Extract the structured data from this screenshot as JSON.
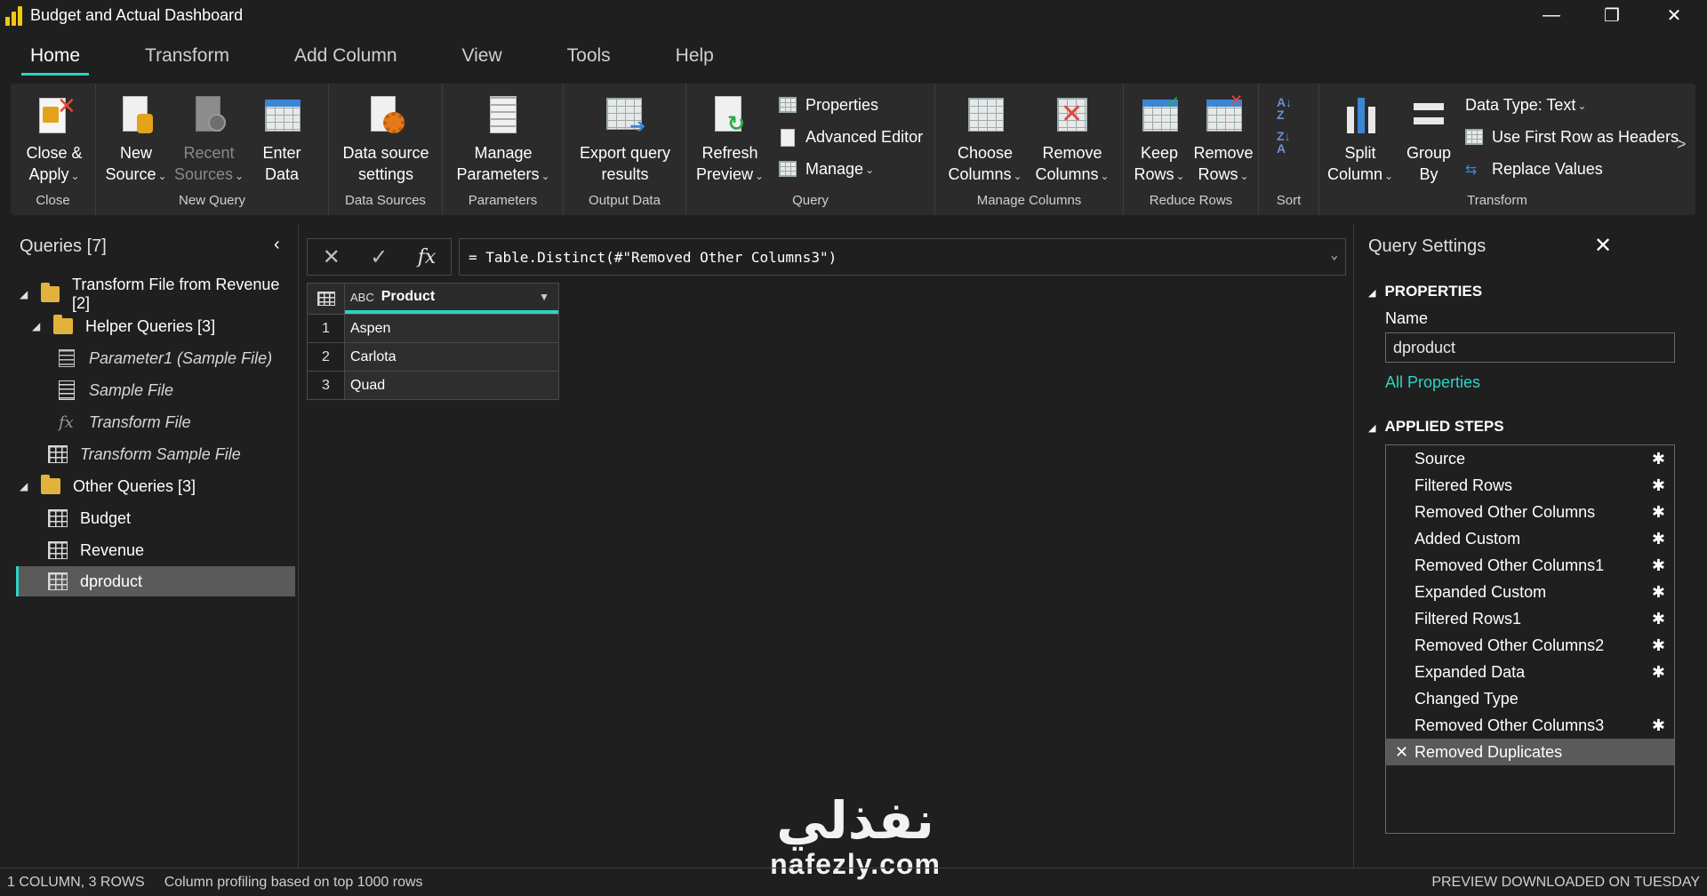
{
  "window": {
    "title": "Budget and Actual Dashboard"
  },
  "menu": {
    "tabs": [
      "Home",
      "Transform",
      "Add Column",
      "View",
      "Tools",
      "Help"
    ],
    "active": "Home"
  },
  "ribbon": {
    "close": {
      "label": "Close",
      "close_apply": "Close &",
      "close_apply2": "Apply"
    },
    "new_query": {
      "label": "New Query",
      "new_source": "New",
      "new_source2": "Source",
      "recent_sources": "Recent",
      "recent_sources2": "Sources",
      "enter_data": "Enter",
      "enter_data2": "Data"
    },
    "data_sources": {
      "label": "Data Sources",
      "settings": "Data source",
      "settings2": "settings"
    },
    "parameters": {
      "label": "Parameters",
      "manage": "Manage",
      "manage2": "Parameters"
    },
    "output_data": {
      "label": "Output Data",
      "export": "Export query",
      "export2": "results"
    },
    "query": {
      "label": "Query",
      "refresh": "Refresh",
      "refresh2": "Preview",
      "properties": "Properties",
      "advanced_editor": "Advanced Editor",
      "manage": "Manage"
    },
    "manage_columns": {
      "label": "Manage Columns",
      "choose": "Choose",
      "choose2": "Columns",
      "remove": "Remove",
      "remove2": "Columns"
    },
    "reduce_rows": {
      "label": "Reduce Rows",
      "keep": "Keep",
      "keep2": "Rows",
      "remove": "Remove",
      "remove2": "Rows"
    },
    "sort": {
      "label": "Sort"
    },
    "transform": {
      "label": "Transform",
      "split": "Split",
      "split2": "Column",
      "group": "Group",
      "group2": "By",
      "data_type": "Data Type: Text",
      "first_row": "Use First Row as Headers",
      "replace": "Replace Values"
    },
    "more": ">"
  },
  "queries": {
    "title": "Queries [7]",
    "items": [
      {
        "label": "Transform File from Revenue [2]"
      },
      {
        "label": "Helper Queries [3]"
      },
      {
        "label": "Parameter1 (Sample File)"
      },
      {
        "label": "Sample File"
      },
      {
        "label": "Transform File"
      },
      {
        "label": "Transform Sample File"
      },
      {
        "label": "Other Queries [3]"
      },
      {
        "label": "Budget"
      },
      {
        "label": "Revenue"
      },
      {
        "label": "dproduct"
      }
    ]
  },
  "formula": {
    "text": "= Table.Distinct(#\"Removed Other Columns3\")"
  },
  "grid": {
    "type_icon": "ABC",
    "column": "Product",
    "rows": [
      {
        "n": "1",
        "value": "Aspen"
      },
      {
        "n": "2",
        "value": "Carlota"
      },
      {
        "n": "3",
        "value": "Quad"
      }
    ]
  },
  "settings": {
    "title": "Query Settings",
    "properties_header": "PROPERTIES",
    "name_label": "Name",
    "name_value": "dproduct",
    "all_properties": "All Properties",
    "steps_header": "APPLIED STEPS",
    "steps": [
      "Source",
      "Filtered Rows",
      "Removed Other Columns",
      "Added Custom",
      "Removed Other Columns1",
      "Expanded Custom",
      "Filtered Rows1",
      "Removed Other Columns2",
      "Expanded Data",
      "Changed Type",
      "Removed Other Columns3",
      "Removed Duplicates"
    ]
  },
  "status": {
    "counts": "1 COLUMN, 3 ROWS",
    "profiling": "Column profiling based on top 1000 rows",
    "preview": "PREVIEW DOWNLOADED ON TUESDAY"
  },
  "watermark": {
    "arabic": "نفذلي",
    "latin": "nafezly.com"
  },
  "colors": {
    "accent": "#2ed3c4",
    "background": "#1f1f1f",
    "ribbon": "#2b2b2b",
    "selected": "#5a5a5a"
  }
}
